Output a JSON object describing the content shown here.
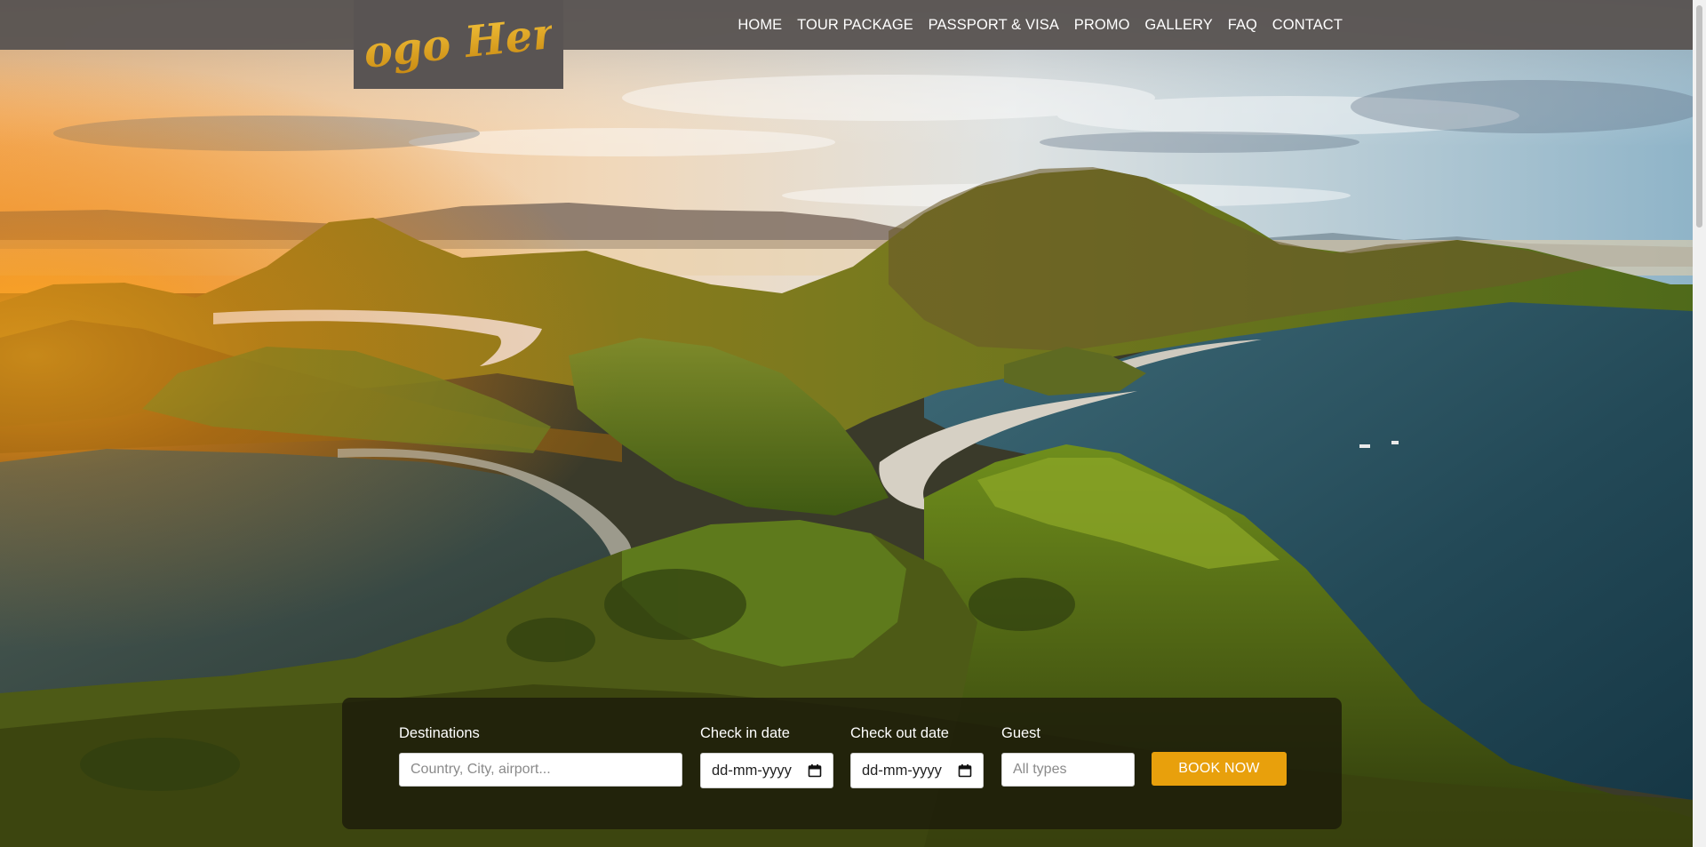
{
  "brand": {
    "logo_text": "Logo Here"
  },
  "nav": {
    "items": [
      {
        "label": "HOME"
      },
      {
        "label": "TOUR PACKAGE"
      },
      {
        "label": "PASSPORT & VISA"
      },
      {
        "label": "PROMO"
      },
      {
        "label": "GALLERY"
      },
      {
        "label": "FAQ"
      },
      {
        "label": "CONTACT"
      }
    ]
  },
  "booking": {
    "destination": {
      "label": "Destinations",
      "placeholder": "Country, City, airport..."
    },
    "check_in": {
      "label": "Check in date",
      "value": "dd-mm-yyyy",
      "icon": "calendar-icon"
    },
    "check_out": {
      "label": "Check out date",
      "value": "dd-mm-yyyy",
      "icon": "calendar-icon"
    },
    "guest": {
      "label": "Guest",
      "placeholder": "All types"
    },
    "submit_label": "BOOK NOW"
  },
  "colors": {
    "accent": "#e8a00c",
    "topbar": "#5a5452",
    "panel": "#1c1a0a"
  }
}
